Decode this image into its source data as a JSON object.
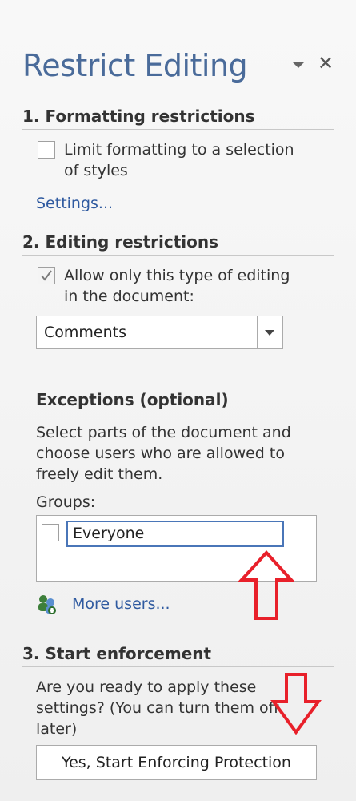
{
  "pane": {
    "title": "Restrict Editing",
    "menu_icon": "dropdown-triangle-icon",
    "close_icon": "close-icon",
    "close_glyph": "✕"
  },
  "formatting": {
    "heading": "1. Formatting restrictions",
    "checkbox_checked": false,
    "checkbox_label_line1": "Limit formatting to a selection",
    "checkbox_label_line2": "of styles",
    "settings_link": "Settings..."
  },
  "editing": {
    "heading": "2. Editing restrictions",
    "checkbox_checked": true,
    "checkbox_label_line1": "Allow only this type of editing",
    "checkbox_label_line2": "in the document:",
    "dropdown_value": "Comments",
    "exceptions_heading": "Exceptions (optional)",
    "exceptions_desc_line1": "Select parts of the document and",
    "exceptions_desc_line2": "choose users who are allowed to",
    "exceptions_desc_line3": "freely edit them.",
    "groups_label": "Groups:",
    "group_item": "Everyone",
    "more_users_link": "More users..."
  },
  "enforcement": {
    "heading": "3. Start enforcement",
    "desc_line1": "Are you ready to apply these",
    "desc_line2": "settings? (You can turn them off",
    "desc_line3": "later)",
    "button_label": "Yes, Start Enforcing Protection"
  },
  "colors": {
    "title": "#4a6b9a",
    "link": "#2f5aa0",
    "annotation_arrow": "#e8202a",
    "input_focus": "#4a76b8"
  },
  "annotations": {
    "arrow_up_icon": "red-up-arrow-icon",
    "arrow_down_icon": "red-down-arrow-icon"
  }
}
